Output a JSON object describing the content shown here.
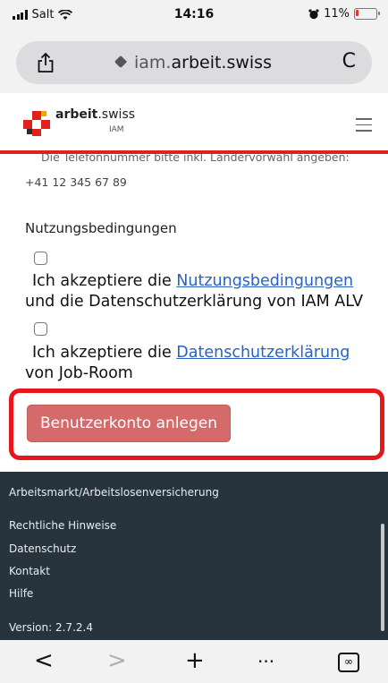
{
  "status": {
    "carrier": "Salt",
    "time": "14:16",
    "battery": "11%"
  },
  "browser": {
    "url_prefix": "iam.",
    "url_domain": "arbeit.swiss"
  },
  "site": {
    "logo_name_bold": "arbeit",
    "logo_name_rest": ".swiss",
    "logo_sub": "IAM"
  },
  "form": {
    "phone_hint": "Die Telefonnummer bitte inkl. Ländervorwahl angeben:",
    "phone_example": "+41 12 345 67 89",
    "terms_heading": "Nutzungsbedingungen",
    "accept1_prefix": "Ich akzeptiere die ",
    "accept1_link": "Nutzungsbedingungen",
    "accept1_suffix": "und die Datenschutzerklärung von IAM ALV",
    "accept2_prefix": "Ich akzeptiere die ",
    "accept2_link": "Datenschutzerklärung",
    "accept2_suffix": "von Job-Room",
    "submit_label": "Benutzerkonto anlegen"
  },
  "footer": {
    "title": "Arbeitsmarkt/Arbeitslosenversicherung",
    "links": [
      "Rechtliche Hinweise",
      "Datenschutz",
      "Kontakt",
      "Hilfe"
    ],
    "version": "Version: 2.7.2.4"
  },
  "toolbar": {
    "back": "<",
    "forward": ">",
    "new_tab": "+",
    "more": "···",
    "tabs": "∞"
  },
  "colors": {
    "accent_red": "#e0201c",
    "button": "#d46a69",
    "footer_bg": "#27343e",
    "link": "#2962c4"
  }
}
